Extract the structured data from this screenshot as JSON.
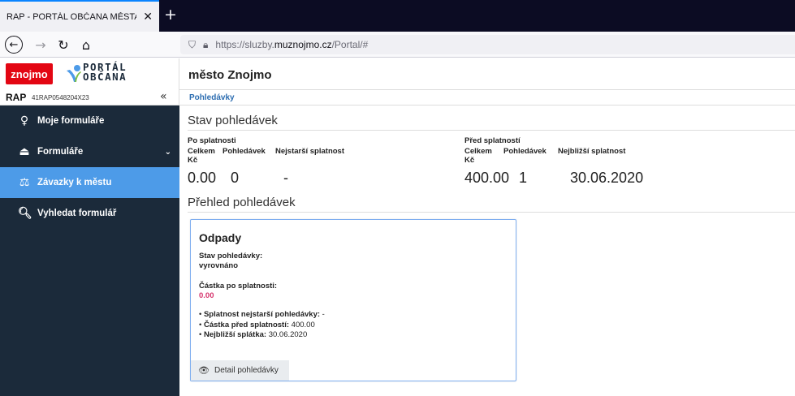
{
  "browser": {
    "tab_title": "RAP - PORTÁL OBČANA MĚSTA ZNOJMO",
    "tab_close": "✕",
    "new_tab": "+",
    "url_prefix": "https://sluzby.",
    "url_domain": "muznojmo.cz",
    "url_suffix": "/Portal/#"
  },
  "sidebar": {
    "logo_text": "znojmo",
    "portal_line1": "PORTÁL",
    "portal_line2": "OBČANA",
    "rap_label": "RAP",
    "rap_id": "41RAP0548204X23",
    "collapse": "«",
    "items": [
      {
        "label": "Moje formuláře",
        "icon": "user-icon",
        "active": false
      },
      {
        "label": "Formuláře",
        "icon": "inbox-icon",
        "active": false
      },
      {
        "label": "Závazky k městu",
        "icon": "scales-icon",
        "active": true
      },
      {
        "label": "Vyhledat formulář",
        "icon": "search-icon",
        "active": false
      }
    ]
  },
  "header": {
    "title": "město Znojmo"
  },
  "breadcrumb": {
    "current": "Pohledávky"
  },
  "status": {
    "title": "Stav pohledávek",
    "overdue": {
      "title": "Po splatnosti",
      "headers": [
        "Celkem Kč",
        "Pohledávek",
        "Nejstarší splatnost"
      ],
      "values": [
        "0.00",
        "0",
        "-"
      ]
    },
    "before_due": {
      "title": "Před splatností",
      "headers": [
        "Celkem Kč",
        "Pohledávek",
        "Nejbližší splatnost"
      ],
      "values": [
        "400.00",
        "1",
        "30.06.2020"
      ]
    }
  },
  "overview": {
    "title": "Přehled pohledávek",
    "card": {
      "title": "Odpady",
      "state_label": "Stav pohledávky:",
      "state_value": "vyrovnáno",
      "overdue_label": "Částka po splatnosti:",
      "overdue_value": "0.00",
      "bullets": [
        {
          "label": "Splatnost nejstarší pohledávky:",
          "value": " -"
        },
        {
          "label": "Částka před splatností:",
          "value": " 400.00"
        },
        {
          "label": "Nejbližší splátka:",
          "value": " 30.06.2020"
        }
      ],
      "detail_button": "Detail pohledávky"
    }
  },
  "colors": {
    "sidebar_bg": "#1b2a3a",
    "active": "#4d9be8",
    "accent_pink": "#d6336c",
    "brand_red": "#e30613"
  }
}
